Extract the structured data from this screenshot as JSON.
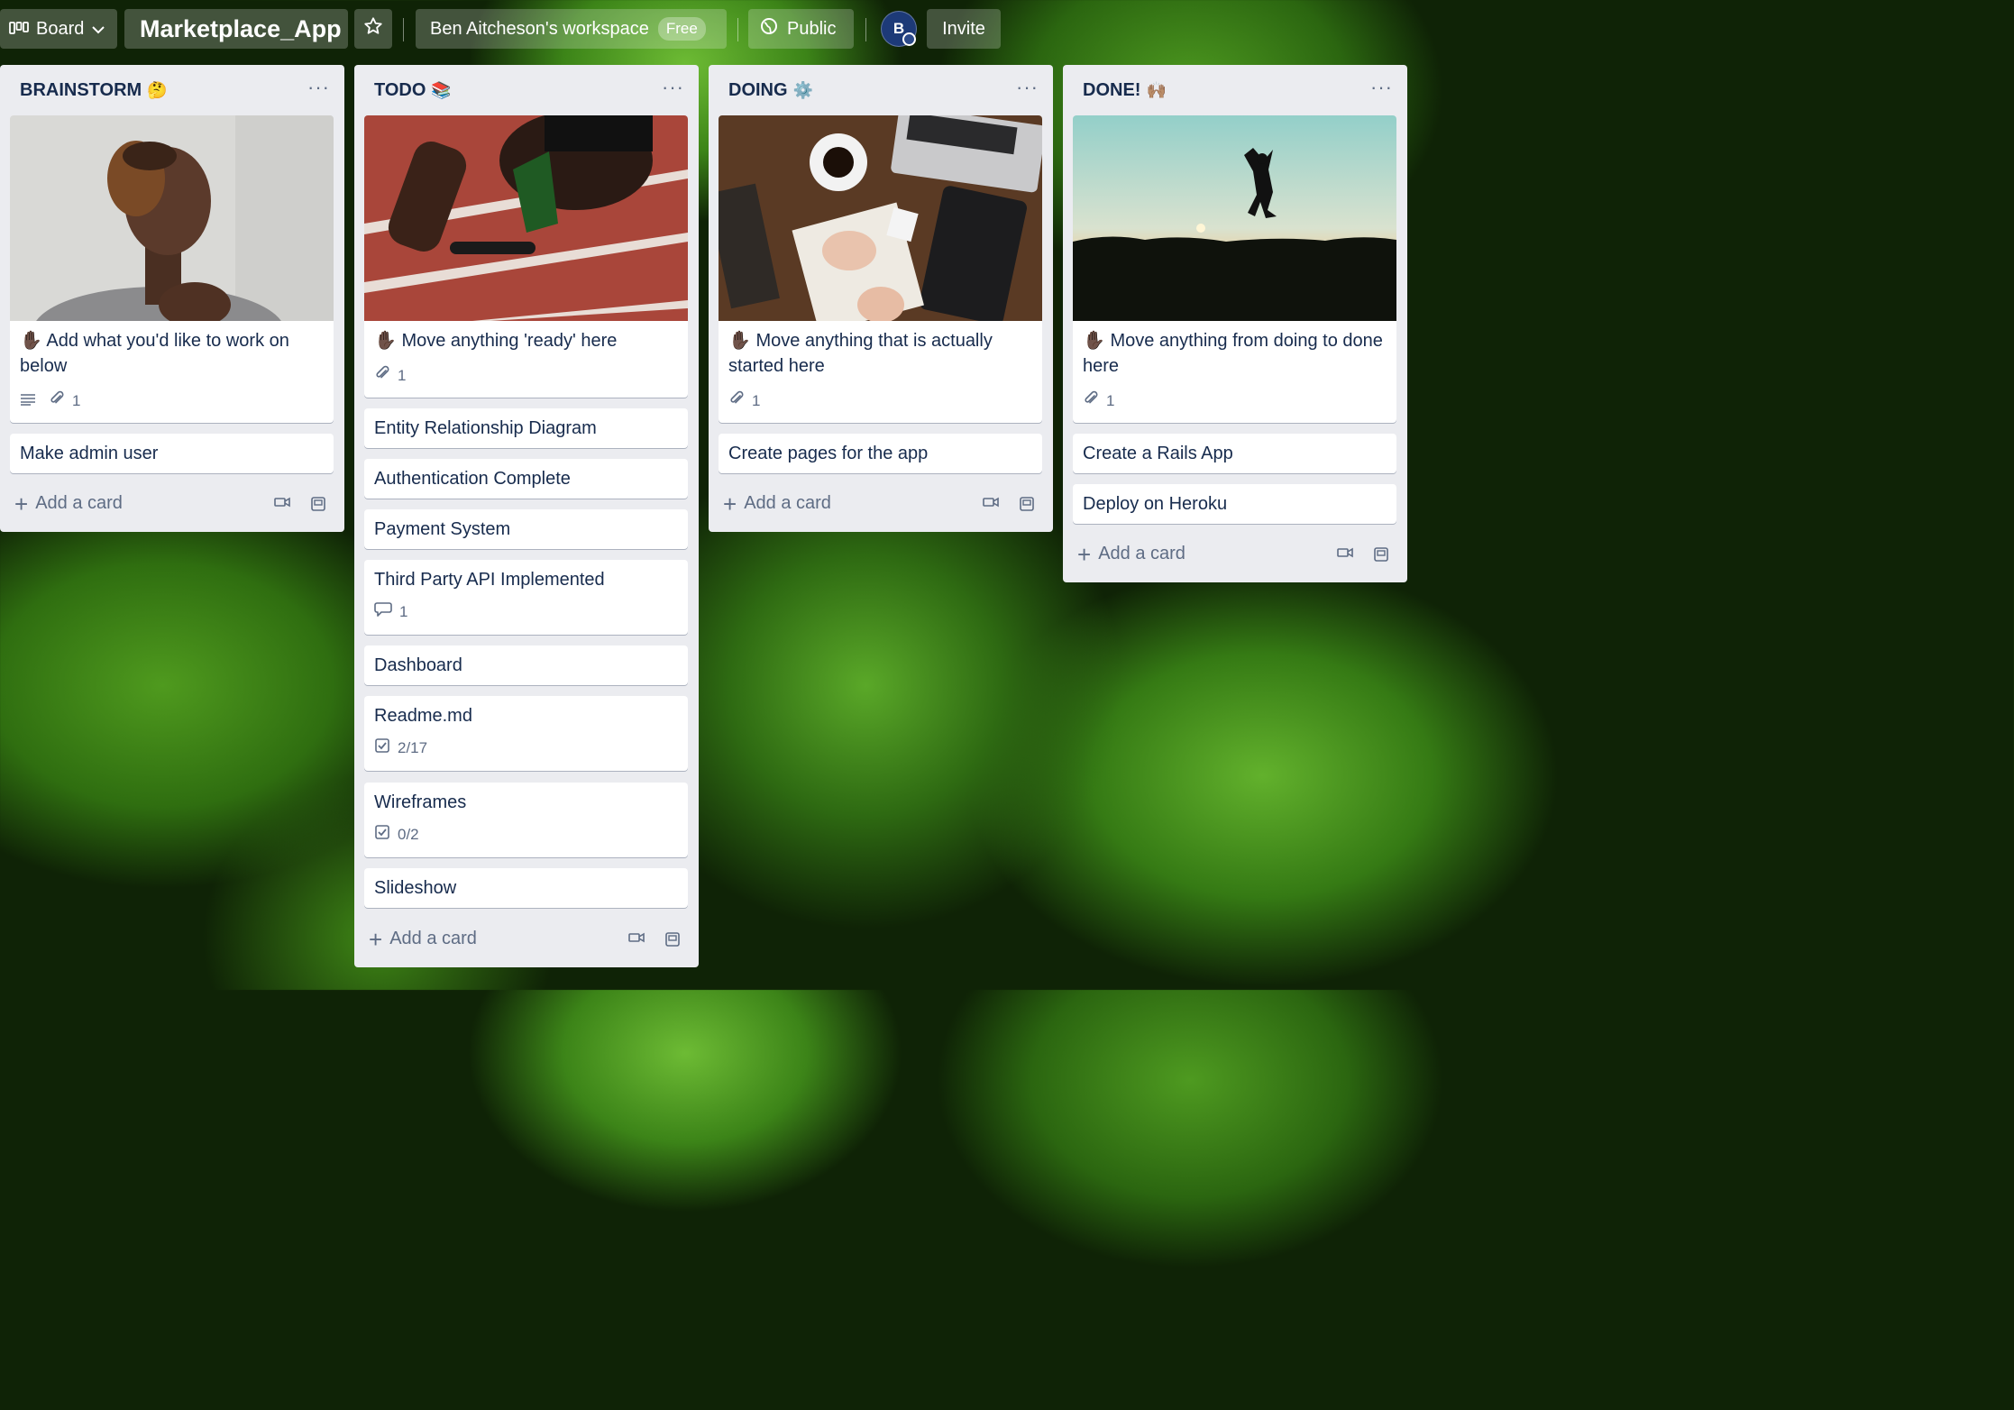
{
  "topbar": {
    "view_label": "Board",
    "board_title": "Marketplace_App",
    "workspace_name": "Ben Aitcheson's workspace",
    "workspace_plan": "Free",
    "visibility": "Public",
    "avatar_initial": "B",
    "invite_label": "Invite"
  },
  "lists": [
    {
      "title": "BRAINSTORM",
      "emoji": "🤔",
      "cover_card": {
        "text": "✋🏿 Add what you'd like to work on below",
        "attachments": "1",
        "has_description": true
      },
      "cards": [
        {
          "text": "Make admin user"
        }
      ],
      "add_label": "Add a card"
    },
    {
      "title": "TODO",
      "emoji": "📚",
      "cover_card": {
        "text": "✋🏿 Move anything 'ready' here",
        "attachments": "1"
      },
      "cards": [
        {
          "text": "Entity Relationship Diagram"
        },
        {
          "text": "Authentication Complete"
        },
        {
          "text": "Payment System"
        },
        {
          "text": "Third Party API Implemented",
          "comments": "1"
        },
        {
          "text": "Dashboard"
        },
        {
          "text": "Readme.md",
          "checklist": "2/17"
        },
        {
          "text": "Wireframes",
          "checklist": "0/2"
        },
        {
          "text": "Slideshow"
        }
      ],
      "add_label": "Add a card"
    },
    {
      "title": "DOING",
      "emoji": "⚙️",
      "cover_card": {
        "text": "✋🏿 Move anything that is actually started here",
        "attachments": "1"
      },
      "cards": [
        {
          "text": "Create pages for the app"
        }
      ],
      "add_label": "Add a card"
    },
    {
      "title": "DONE!",
      "emoji": "🙌🏽",
      "cover_card": {
        "text": "✋🏿 Move anything from doing to done here",
        "attachments": "1"
      },
      "cards": [
        {
          "text": "Create a Rails App"
        },
        {
          "text": "Deploy on Heroku"
        }
      ],
      "add_label": "Add a card"
    }
  ]
}
